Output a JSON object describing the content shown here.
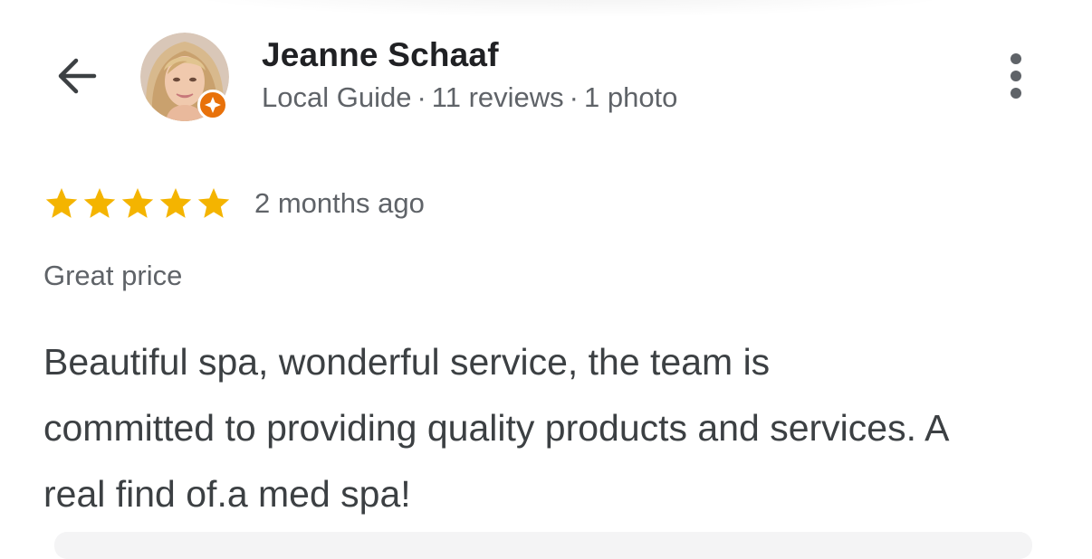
{
  "reviewer": {
    "name": "Jeanne Schaaf",
    "badge": "Local Guide",
    "separator": "·",
    "reviews": "11 reviews",
    "photos": "1 photo"
  },
  "review": {
    "rating": 5,
    "rating_max": 5,
    "time": "2 months ago",
    "tag": "Great price",
    "text": "Beautiful spa, wonderful service, the team is committed to providing quality products and services. A real find of.a med spa!"
  },
  "icons": {
    "back": "arrow-back-icon",
    "more": "more-vert-icon",
    "star": "star-icon",
    "local_guide": "local-guide-badge-icon"
  },
  "colors": {
    "star": "#f4b400",
    "local_guide_badge": "#e8710a",
    "primary_text": "#202124",
    "secondary_text": "#5f6368",
    "body_text": "#3c4043"
  }
}
